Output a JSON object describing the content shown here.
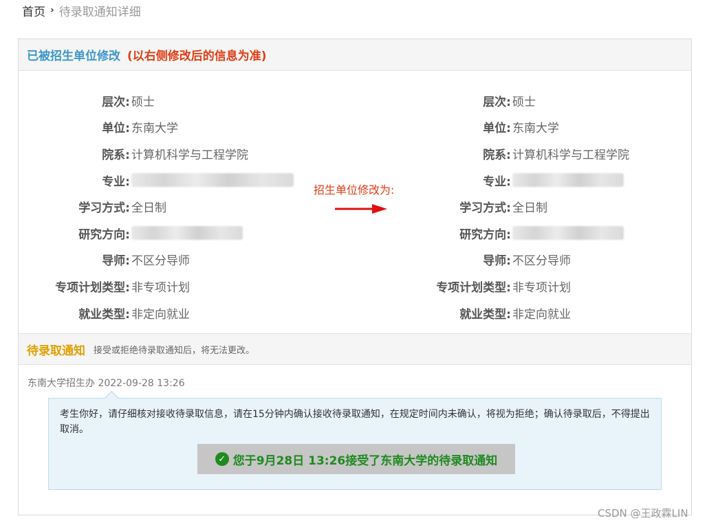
{
  "breadcrumb": {
    "home": "首页",
    "separator": "›",
    "current": "待录取通知详细"
  },
  "modified_section": {
    "title": "已被招生单位修改",
    "note": "(以右侧修改后的信息为准)",
    "change_label": "招生单位修改为:",
    "original": [
      {
        "label": "层次:",
        "value": "硕士"
      },
      {
        "label": "单位:",
        "value": "东南大学"
      },
      {
        "label": "院系:",
        "value": "计算机科学与工程学院"
      },
      {
        "label": "专业:",
        "value": "",
        "redacted": true
      },
      {
        "label": "学习方式:",
        "value": "全日制"
      },
      {
        "label": "研究方向:",
        "value": "",
        "redacted": true
      },
      {
        "label": "导师:",
        "value": "不区分导师"
      },
      {
        "label": "专项计划类型:",
        "value": "非专项计划"
      },
      {
        "label": "就业类型:",
        "value": "非定向就业"
      }
    ],
    "modified": [
      {
        "label": "层次:",
        "value": "硕士"
      },
      {
        "label": "单位:",
        "value": "东南大学"
      },
      {
        "label": "院系:",
        "value": "计算机科学与工程学院"
      },
      {
        "label": "专业:",
        "value": "",
        "redacted": true
      },
      {
        "label": "学习方式:",
        "value": "全日制"
      },
      {
        "label": "研究方向:",
        "value": "",
        "redacted": true
      },
      {
        "label": "导师:",
        "value": "不区分导师"
      },
      {
        "label": "专项计划类型:",
        "value": "非专项计划"
      },
      {
        "label": "就业类型:",
        "value": "非定向就业"
      }
    ]
  },
  "notice_section": {
    "title": "待录取通知",
    "note": "接受或拒绝待录取通知后，将无法更改。",
    "sender": "东南大学招生办",
    "timestamp": "2022-09-28 13:26",
    "message": "考生你好，请仔细核对接收待录取信息，请在15分钟内确认接收待录取通知，在规定时间内未确认，将视为拒绝；确认待录取后，不得提出取消。",
    "status_icon": "check-circle-icon",
    "status": "您于9月28日 13:26接受了东南大学的待录取通知"
  },
  "watermark": "CSDN @王政霖LIN",
  "colors": {
    "section_title": "#3d96c9",
    "warning_note": "#e03c14",
    "notice_title": "#e0a000",
    "success": "#1f8a1f",
    "message_bg": "#e8f4fa"
  }
}
